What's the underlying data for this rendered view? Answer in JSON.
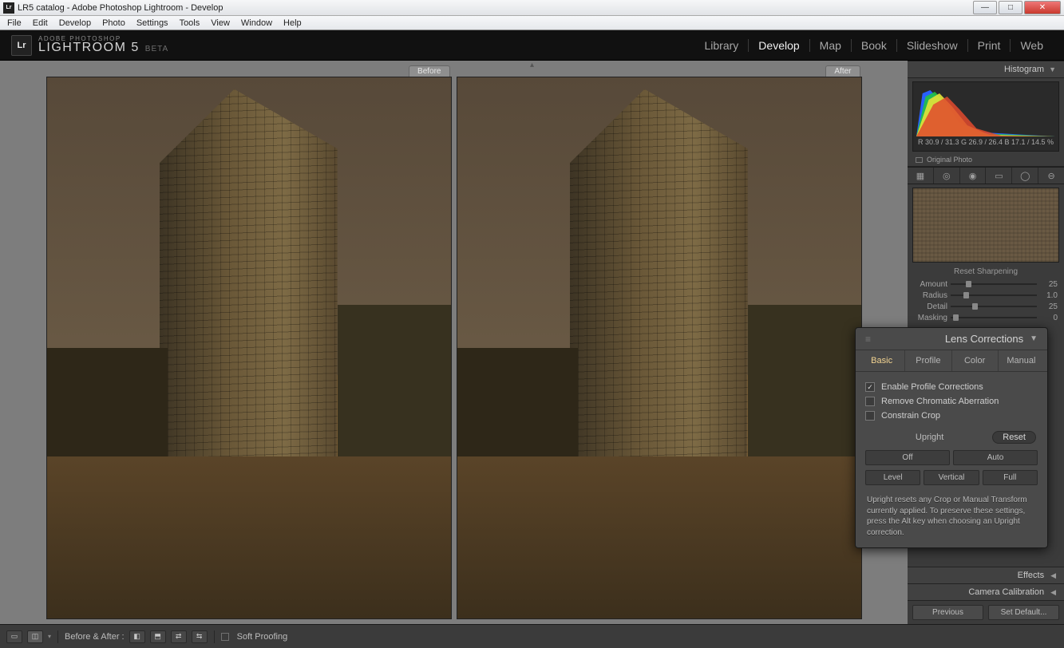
{
  "window": {
    "title": "LR5 catalog - Adobe Photoshop Lightroom - Develop"
  },
  "menubar": [
    "File",
    "Edit",
    "Develop",
    "Photo",
    "Settings",
    "Tools",
    "View",
    "Window",
    "Help"
  ],
  "header": {
    "brand": "ADOBE PHOTOSHOP",
    "product": "LIGHTROOM 5",
    "tag": "BETA",
    "logo": "Lr"
  },
  "modules": {
    "items": [
      "Library",
      "Develop",
      "Map",
      "Book",
      "Slideshow",
      "Print",
      "Web"
    ],
    "active": "Develop"
  },
  "compare": {
    "before": "Before",
    "after": "After"
  },
  "right": {
    "histogram": {
      "title": "Histogram",
      "readout": {
        "r": "R 30.9 / 31.3",
        "g": "G 26.9 / 26.4",
        "b": "B 17.1 / 14.5",
        "pct": "%"
      },
      "original_photo": "Original Photo"
    },
    "sharpening": {
      "title": "Reset Sharpening",
      "rows": [
        {
          "label": "Amount",
          "value": "25",
          "pos": 18
        },
        {
          "label": "Radius",
          "value": "1.0",
          "pos": 15
        },
        {
          "label": "Detail",
          "value": "25",
          "pos": 25
        },
        {
          "label": "Masking",
          "value": "0",
          "pos": 3
        }
      ]
    },
    "effects_title": "Effects",
    "camera_cal_title": "Camera Calibration",
    "footer": {
      "previous": "Previous",
      "set_default": "Set Default..."
    }
  },
  "lens": {
    "title": "Lens Corrections",
    "tabs": [
      "Basic",
      "Profile",
      "Color",
      "Manual"
    ],
    "active_tab": "Basic",
    "checks": {
      "enable": {
        "label": "Enable Profile Corrections",
        "checked": true
      },
      "chroma": {
        "label": "Remove Chromatic Aberration",
        "checked": false
      },
      "crop": {
        "label": "Constrain Crop",
        "checked": false
      }
    },
    "upright_label": "Upright",
    "reset_label": "Reset",
    "buttons_row1": [
      "Off",
      "Auto"
    ],
    "buttons_row2": [
      "Level",
      "Vertical",
      "Full"
    ],
    "info": "Upright resets any Crop or Manual Transform currently applied. To preserve these settings, press the Alt key when choosing an Upright correction."
  },
  "bottombar": {
    "before_after_label": "Before & After :",
    "soft_proofing": "Soft Proofing"
  }
}
